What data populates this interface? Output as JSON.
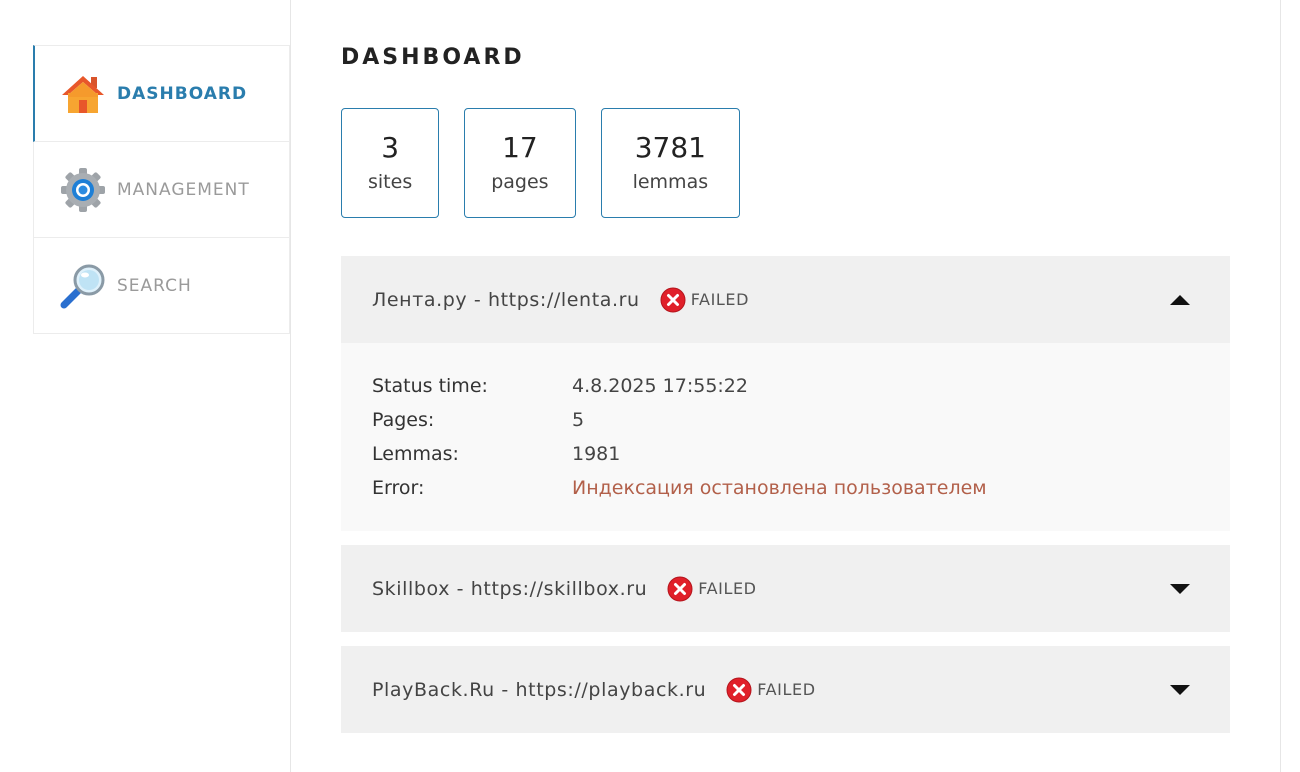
{
  "sidebar": {
    "items": [
      {
        "label": "DASHBOARD",
        "icon": "home-icon",
        "active": true
      },
      {
        "label": "MANAGEMENT",
        "icon": "gear-icon",
        "active": false
      },
      {
        "label": "SEARCH",
        "icon": "magnifier-icon",
        "active": false
      }
    ]
  },
  "main": {
    "title": "DASHBOARD",
    "stats": [
      {
        "value": "3",
        "label": "sites"
      },
      {
        "value": "17",
        "label": "pages"
      },
      {
        "value": "3781",
        "label": "lemmas"
      }
    ],
    "sites": [
      {
        "name": "Лента.ру - https://lenta.ru",
        "status": "FAILED",
        "expanded": true,
        "details": {
          "status_time_label": "Status time:",
          "status_time": "4.8.2025 17:55:22",
          "pages_label": "Pages:",
          "pages": "5",
          "lemmas_label": "Lemmas:",
          "lemmas": "1981",
          "error_label": "Error:",
          "error": "Индексация остановлена пользователем"
        }
      },
      {
        "name": "Skillbox - https://skillbox.ru",
        "status": "FAILED",
        "expanded": false
      },
      {
        "name": "PlayBack.Ru - https://playback.ru",
        "status": "FAILED",
        "expanded": false
      }
    ]
  },
  "colors": {
    "accent": "#2a7dad",
    "failed": "#e0202a",
    "error_text": "#b2604a",
    "panel": "#f0f0f0"
  }
}
